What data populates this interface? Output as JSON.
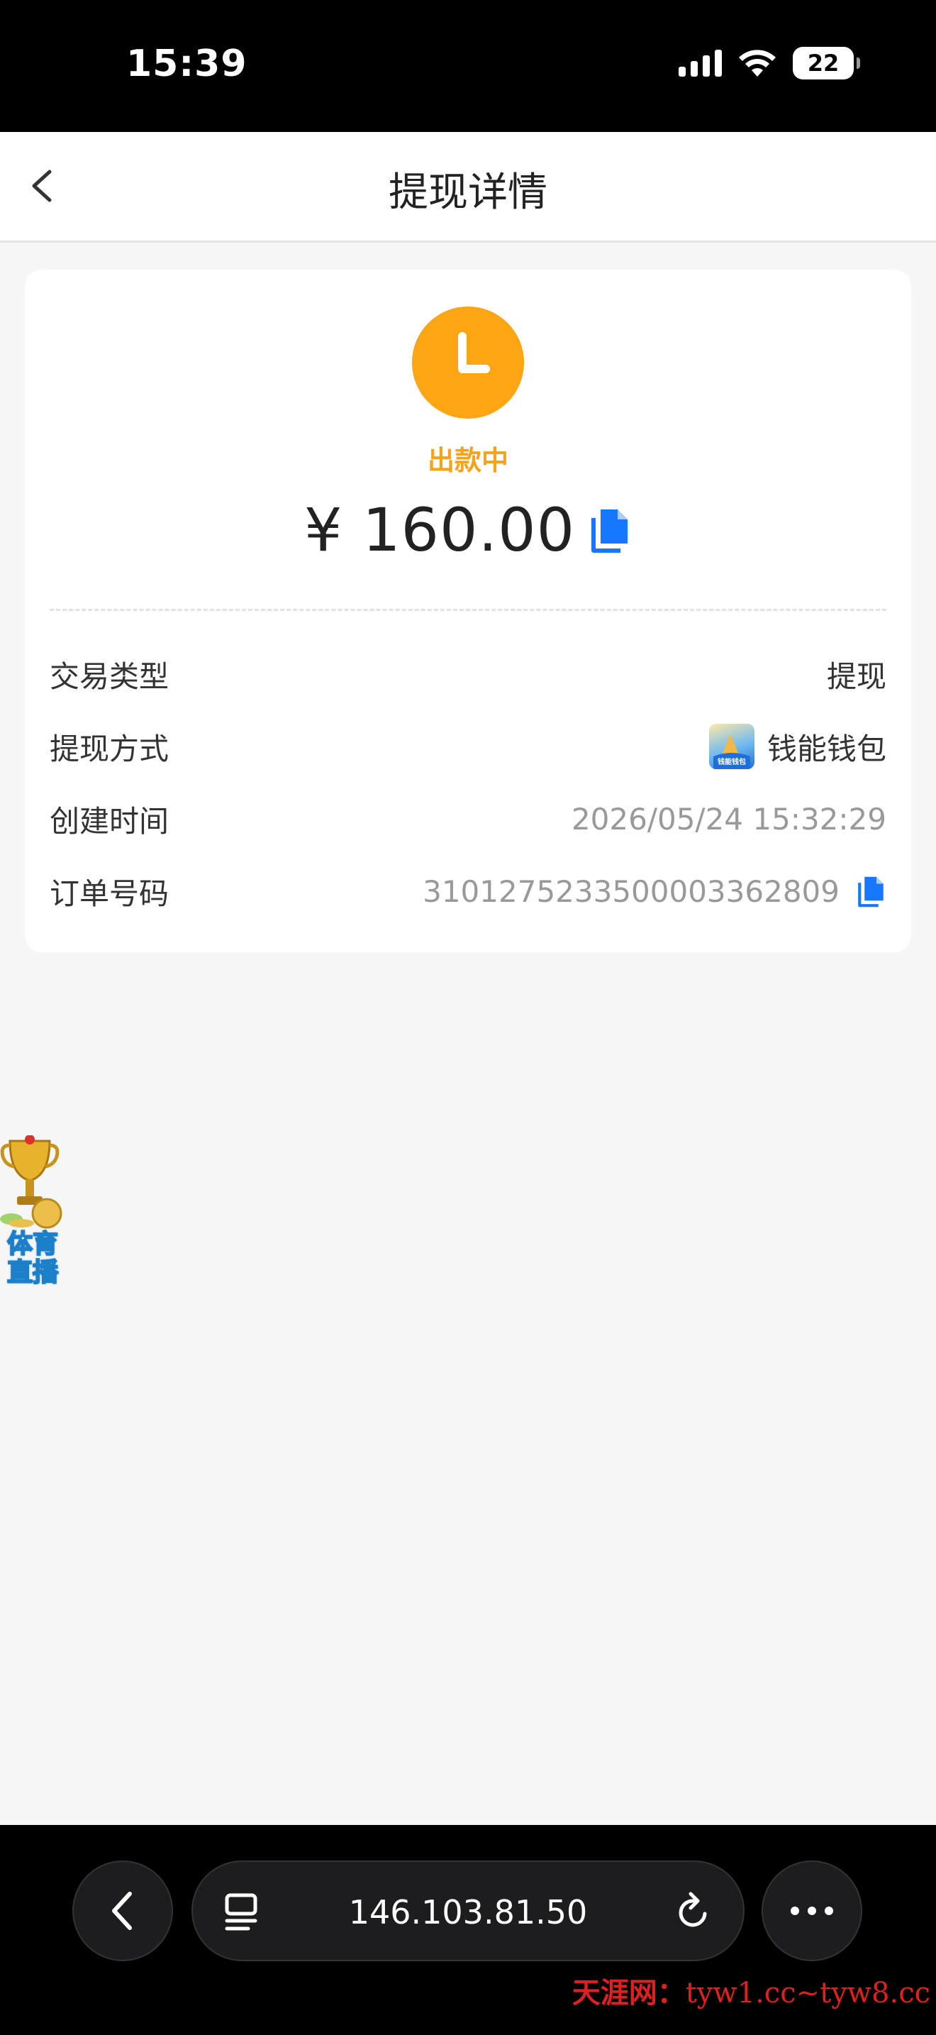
{
  "status_bar": {
    "time": "15:39",
    "battery": "22"
  },
  "header": {
    "title": "提现详情"
  },
  "withdrawal": {
    "status": "出款中",
    "amount": "¥ 160.00",
    "rows": [
      {
        "label": "交易类型",
        "value": "提现"
      },
      {
        "label": "提现方式",
        "value": "钱能钱包",
        "logo_text": "钱能钱包"
      },
      {
        "label": "创建时间",
        "value": "2026/05/24 15:32:29"
      },
      {
        "label": "订单号码",
        "value": "3101275233500003362809"
      }
    ]
  },
  "float_badge": {
    "text_line1": "体育",
    "text_line2": "直播"
  },
  "browser": {
    "url": "146.103.81.50"
  },
  "watermark": {
    "site": "天涯网：",
    "domains": "tyw1.cc~tyw8.cc"
  },
  "colors": {
    "status_orange": "#fda512",
    "copy_blue": "#1677ff",
    "watermark_red": "#e02020"
  },
  "icons": [
    "back-chevron-icon",
    "clock-icon",
    "copy-icon",
    "trophy-icon",
    "tabs-icon",
    "reload-icon",
    "more-icon"
  ]
}
